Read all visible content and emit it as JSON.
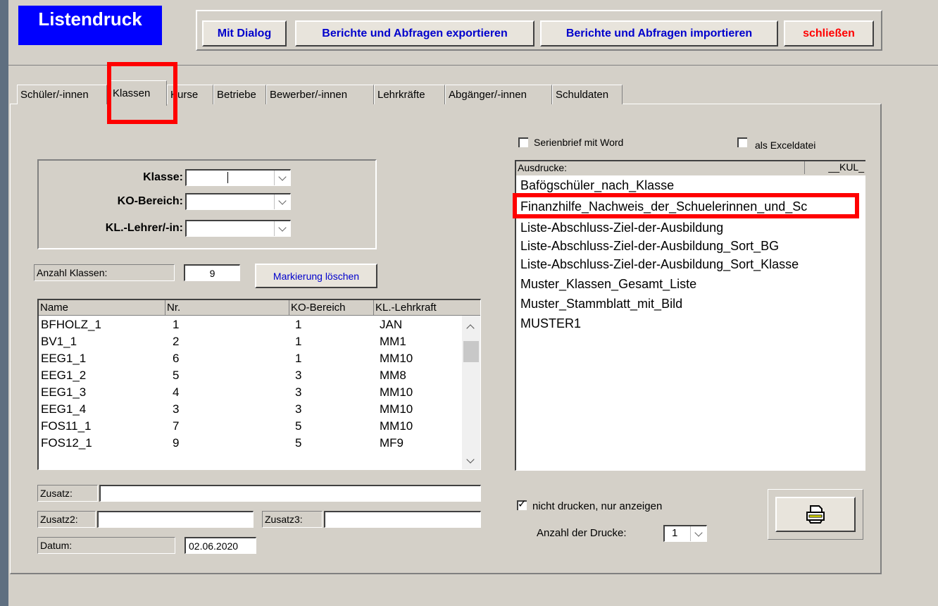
{
  "app": {
    "title": "Listendruck"
  },
  "toolbar": {
    "mit_dialog": "Mit Dialog",
    "export": "Berichte und Abfragen exportieren",
    "import": "Berichte und Abfragen importieren",
    "close": "schließen",
    "close_color": "#ff0000",
    "accent": "#0000ff"
  },
  "tabs": [
    "Schüler/-innen",
    "Klassen",
    "Kurse",
    "Betriebe",
    "Bewerber/-innen",
    "Lehrkräfte",
    "Abgänger/-innen",
    "Schuldaten"
  ],
  "active_tab": "Klassen",
  "filters": {
    "klasse_label": "Klasse:",
    "ko_label": "KO-Bereich:",
    "lehrer_label": "KL.-Lehrer/-in:"
  },
  "count": {
    "label": "Anzahl Klassen:",
    "value": "9"
  },
  "clear_button": "Markierung löschen",
  "class_list": {
    "headers": [
      "Name",
      "Nr.",
      "KO-Bereich",
      "KL.-Lehrkraft"
    ],
    "rows": [
      [
        "BFHOLZ_1",
        "1",
        "1",
        "JAN"
      ],
      [
        "BV1_1",
        "2",
        "1",
        "MM1"
      ],
      [
        "EEG1_1",
        "6",
        "1",
        "MM10"
      ],
      [
        "EEG1_2",
        "5",
        "3",
        "MM8"
      ],
      [
        "EEG1_3",
        "4",
        "3",
        "MM10"
      ],
      [
        "EEG1_4",
        "3",
        "3",
        "MM10"
      ],
      [
        "FOS11_1",
        "7",
        "5",
        "MM10"
      ],
      [
        "FOS12_1",
        "9",
        "5",
        "MF9"
      ]
    ]
  },
  "extra_fields": {
    "zusatz": "Zusatz:",
    "zusatz2": "Zusatz2:",
    "zusatz3": "Zusatz3:",
    "datum_label": "Datum:",
    "datum_value": "02.06.2020"
  },
  "options": {
    "serienbrief": "Serienbrief mit Word",
    "excel": "als Exceldatei",
    "nicht_drucken": "nicht drucken, nur anzeigen",
    "copies_label": "Anzahl der Drucke:",
    "copies_value": "1"
  },
  "reports": {
    "header": "Ausdrucke:",
    "header_right": "__KUL_",
    "items": [
      "Bafögschüler_nach_Klasse",
      "Finanzhilfe_Nachweis_der_Schuelerinnen_und_Sc",
      "Liste-Abschluss-Ziel-der-Ausbildung",
      "Liste-Abschluss-Ziel-der-Ausbildung_Sort_BG",
      "Liste-Abschluss-Ziel-der-Ausbildung_Sort_Klasse",
      "Muster_Klassen_Gesamt_Liste",
      "Muster_Stammblatt_mit_Bild",
      "MUSTER1"
    ]
  },
  "icons": {
    "print": "printer-icon"
  }
}
